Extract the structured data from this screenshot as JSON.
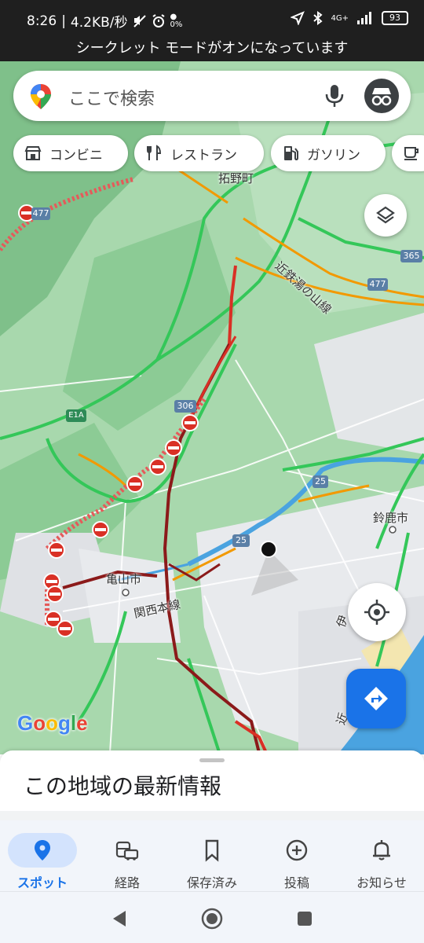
{
  "status_bar": {
    "time": "8:26",
    "speed": "4.2KB/秒",
    "data_pct": "0%",
    "network": "4G+",
    "battery": "93"
  },
  "incognito_banner": "シークレット モードがオンになっています",
  "search": {
    "placeholder": "ここで検索",
    "pin_icon": "maps-pin-icon",
    "mic_icon": "mic-icon",
    "avatar_icon": "incognito-icon"
  },
  "chips": [
    {
      "label": "コンビニ",
      "icon": "store-icon"
    },
    {
      "label": "レストラン",
      "icon": "restaurant-icon"
    },
    {
      "label": "ガソリン",
      "icon": "gas-station-icon"
    },
    {
      "label": "",
      "icon": "coffee-icon"
    }
  ],
  "map": {
    "labels": {
      "town_tsuge": "拓野町",
      "kintetsu_line": "近鉄湯の山線",
      "kameyama": "亀山市",
      "kansai_line": "関西本線",
      "suzuka": "鈴鹿市",
      "edge_i": "伊",
      "edge_kin": "近"
    },
    "route_shields": {
      "r306": "306",
      "r477a": "477",
      "r477b": "477",
      "r365": "365",
      "r25a": "25",
      "r25b": "25",
      "e1a": "E1A"
    },
    "colors": {
      "land": "#a8d8ad",
      "urban": "#e8eaed",
      "water": "#4aa3e0",
      "road_clear": "#34c759",
      "road_slow": "#f29900",
      "road_jam": "#d93025",
      "road_heavy": "#8b1a1a"
    }
  },
  "google_logo": [
    "G",
    "o",
    "o",
    "g",
    "l",
    "e"
  ],
  "sheet": {
    "title": "この地域の最新情報"
  },
  "bottom_nav": [
    {
      "label": "スポット",
      "icon": "place-pin-icon",
      "active": true
    },
    {
      "label": "経路",
      "icon": "commute-icon",
      "active": false
    },
    {
      "label": "保存済み",
      "icon": "bookmark-icon",
      "active": false
    },
    {
      "label": "投稿",
      "icon": "add-circle-icon",
      "active": false
    },
    {
      "label": "お知らせ",
      "icon": "bell-icon",
      "active": false
    }
  ]
}
